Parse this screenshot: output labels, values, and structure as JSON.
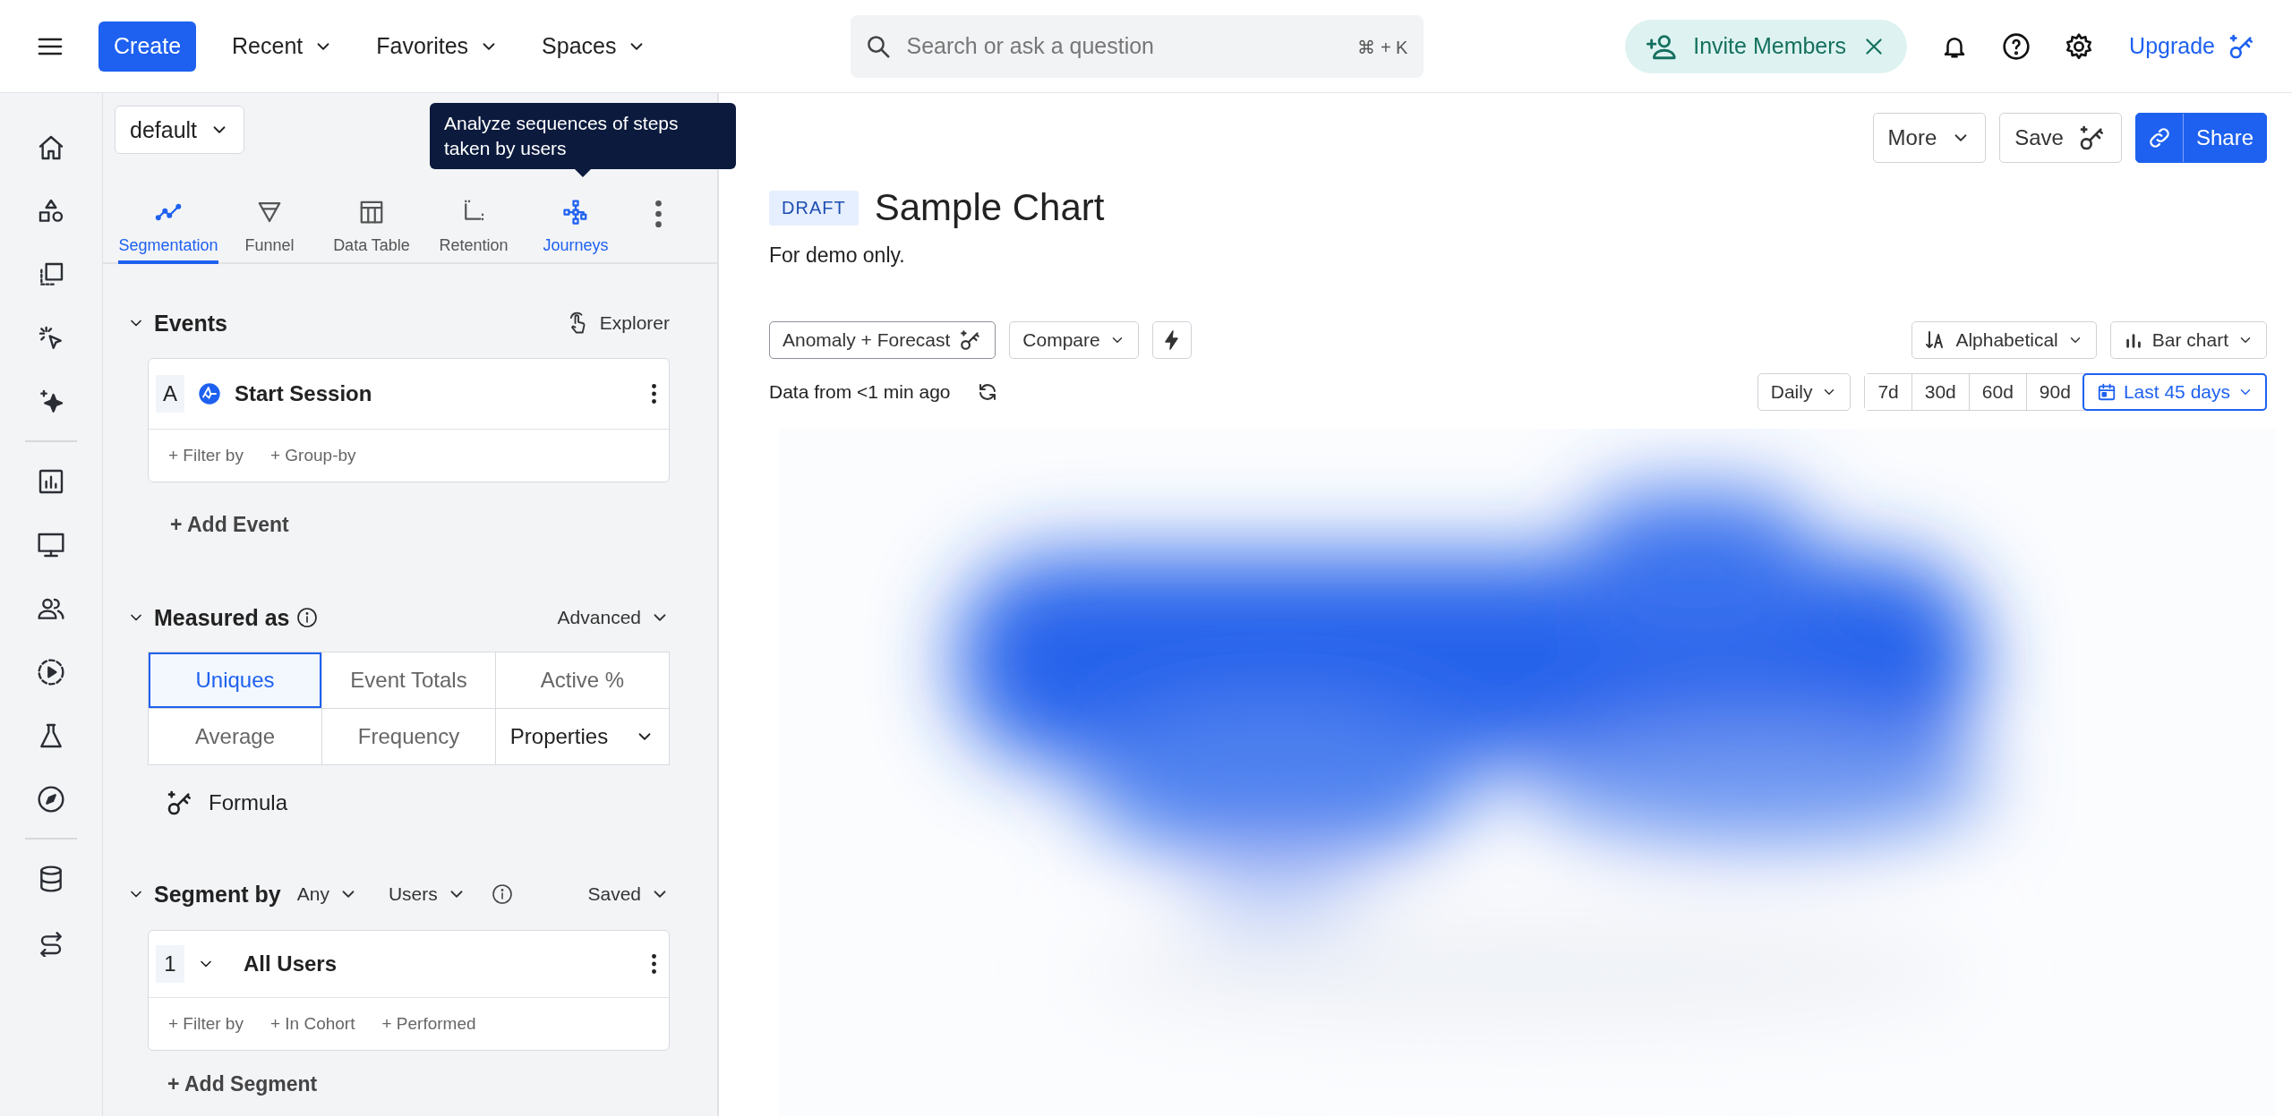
{
  "topbar": {
    "create": "Create",
    "menus": [
      {
        "label": "Recent"
      },
      {
        "label": "Favorites"
      },
      {
        "label": "Spaces"
      }
    ],
    "search": {
      "placeholder": "Search or ask a question",
      "shortcut": "⌘ + K"
    },
    "invite": "Invite Members",
    "upgrade": "Upgrade"
  },
  "panel": {
    "dataset": "default",
    "tooltip": "Analyze sequences of steps taken by users",
    "chart_types": [
      {
        "label": "Segmentation",
        "kind": "segmentation",
        "selected": true,
        "highlighted": false
      },
      {
        "label": "Funnel",
        "kind": "funnel",
        "selected": false,
        "highlighted": false
      },
      {
        "label": "Data Table",
        "kind": "table",
        "selected": false,
        "highlighted": false
      },
      {
        "label": "Retention",
        "kind": "retention",
        "selected": false,
        "highlighted": false
      },
      {
        "label": "Journeys",
        "kind": "journeys",
        "selected": false,
        "highlighted": true
      }
    ],
    "events": {
      "title": "Events",
      "explorer": "Explorer",
      "items": [
        {
          "letter": "A",
          "name": "Start Session"
        }
      ],
      "actions": [
        "+ Filter by",
        "+ Group-by"
      ],
      "add": "+ Add Event"
    },
    "measured": {
      "title": "Measured as",
      "mode": "Advanced",
      "options": [
        {
          "label": "Uniques",
          "kind": "option",
          "selected": true
        },
        {
          "label": "Event Totals",
          "kind": "option",
          "selected": false
        },
        {
          "label": "Active %",
          "kind": "option",
          "selected": false
        },
        {
          "label": "Average",
          "kind": "option",
          "selected": false
        },
        {
          "label": "Frequency",
          "kind": "option",
          "selected": false
        },
        {
          "label": "Properties",
          "kind": "dropdown",
          "selected": false
        }
      ],
      "formula": "Formula"
    },
    "segment": {
      "title": "Segment by",
      "any": "Any",
      "users": "Users",
      "saved": "Saved",
      "items": [
        {
          "index": "1",
          "name": "All Users"
        }
      ],
      "actions": [
        "+ Filter by",
        "+ In Cohort",
        "+ Performed"
      ],
      "add": "+ Add Segment"
    }
  },
  "main": {
    "more": "More",
    "save": "Save",
    "share": "Share",
    "badge": "DRAFT",
    "title": "Sample Chart",
    "description": "For demo only.",
    "anomaly": "Anomaly + Forecast",
    "compare": "Compare",
    "sort": "Alphabetical",
    "chart_type": "Bar chart",
    "updated": "Data from <1 min ago",
    "interval": "Daily",
    "ranges": [
      {
        "label": "7d",
        "kind": "preset",
        "selected": false
      },
      {
        "label": "30d",
        "kind": "preset",
        "selected": false
      },
      {
        "label": "60d",
        "kind": "preset",
        "selected": false
      },
      {
        "label": "90d",
        "kind": "preset",
        "selected": false
      },
      {
        "label": "Last 45 days",
        "kind": "custom",
        "selected": true
      }
    ]
  }
}
